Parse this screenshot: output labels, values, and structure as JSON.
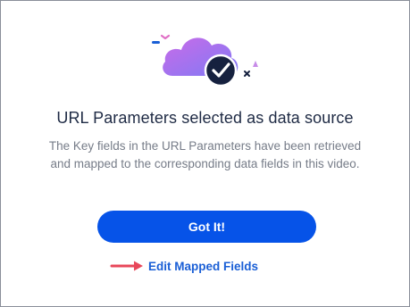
{
  "dialog": {
    "title": "URL Parameters selected as data source",
    "description_line1": "The Key fields in the URL Parameters have been retrieved",
    "description_line2": "and mapped to the corresponding data fields in this video.",
    "primary_button_label": "Got It!",
    "edit_link_label": "Edit Mapped Fields"
  },
  "icons": {
    "illustration": "cloud-check-icon",
    "arrow": "arrow-right-icon"
  },
  "colors": {
    "primary": "#0653e8",
    "link": "#1a5fd6",
    "arrow": "#e8475a",
    "title": "#1e2a44",
    "description": "#767c88",
    "cloud_start": "#c96be8",
    "cloud_end": "#7f7af5",
    "check_circle": "#16213f"
  }
}
